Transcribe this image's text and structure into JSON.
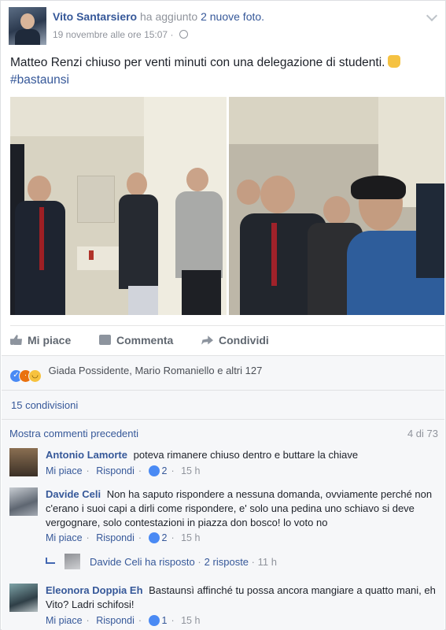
{
  "post": {
    "author_name": "Vito Santarsiero",
    "action_text": "ha aggiunto",
    "photo_count_text": "2 nuove foto.",
    "timestamp": "19 novembre alle ore 15:07",
    "text": "Matteo Renzi chiuso per venti minuti con una delegazione di studenti.",
    "hashtag": "#bastaunsi"
  },
  "actions": {
    "like_label": "Mi piace",
    "comment_label": "Commenta",
    "share_label": "Condividi"
  },
  "reactions": {
    "summary": "Giada Possidente, Mario Romaniello e altri 127"
  },
  "shares_text": "15 condivisioni",
  "comments_header": {
    "view_previous": "Mostra commenti precedenti",
    "counter": "4 di 73"
  },
  "comments": [
    {
      "name": "Antonio Lamorte",
      "text": "poteva rimanere chiuso dentro e buttare la chiave",
      "like_label": "Mi piace",
      "reply_label": "Rispondi",
      "likes": "2",
      "time": "15 h"
    },
    {
      "name": "Davide Celi",
      "text": "Non ha saputo rispondere a nessuna domanda, ovviamente perché non c'erano i suoi capi a dirli come rispondere, e' solo una pedina uno schiavo si deve vergognare, solo contestazioni in piazza don bosco! lo voto no",
      "like_label": "Mi piace",
      "reply_label": "Rispondi",
      "likes": "2",
      "time": "15 h"
    },
    {
      "name": "Eleonora Doppia Eh",
      "text": "Bastaunsì affinché tu possa ancora mangiare a quatto mani, eh Vito? Ladri schifosi!",
      "like_label": "Mi piace",
      "reply_label": "Rispondi",
      "likes": "1",
      "time": "15 h"
    }
  ],
  "reply_summary": {
    "name": "Davide Celi",
    "action": "ha risposto",
    "count": "2 risposte",
    "time": "11 h"
  }
}
